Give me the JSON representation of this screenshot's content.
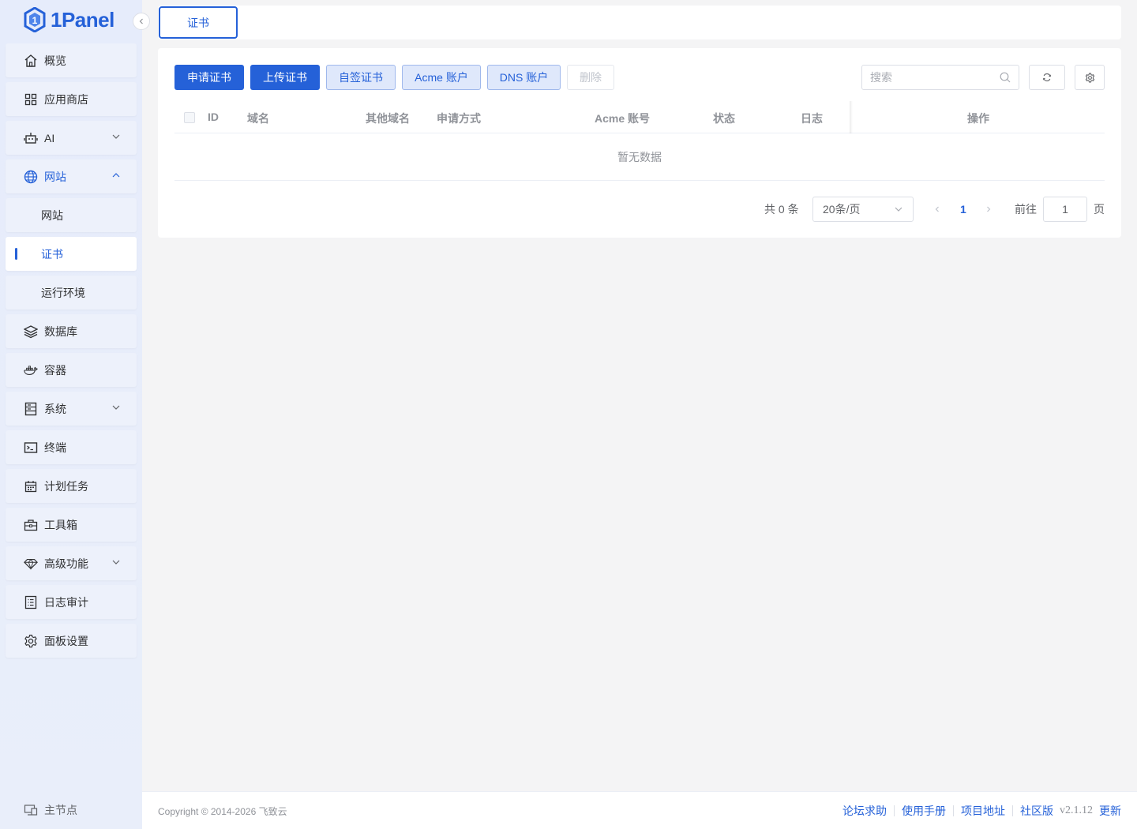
{
  "brand": {
    "name": "1Panel"
  },
  "sidebar": {
    "items": [
      {
        "label": "概览"
      },
      {
        "label": "应用商店"
      },
      {
        "label": "AI"
      },
      {
        "label": "网站"
      },
      {
        "label": "网站"
      },
      {
        "label": "证书"
      },
      {
        "label": "运行环境"
      },
      {
        "label": "数据库"
      },
      {
        "label": "容器"
      },
      {
        "label": "系统"
      },
      {
        "label": "终端"
      },
      {
        "label": "计划任务"
      },
      {
        "label": "工具箱"
      },
      {
        "label": "高级功能"
      },
      {
        "label": "日志审计"
      },
      {
        "label": "面板设置"
      }
    ],
    "node_label": "主节点"
  },
  "tabs": [
    {
      "label": "证书"
    }
  ],
  "toolbar": {
    "apply_label": "申请证书",
    "upload_label": "上传证书",
    "self_signed_label": "自签证书",
    "acme_label": "Acme 账户",
    "dns_label": "DNS 账户",
    "delete_label": "删除",
    "search_placeholder": "搜索"
  },
  "table": {
    "columns": [
      "ID",
      "域名",
      "其他域名",
      "申请方式",
      "Acme 账号",
      "状态",
      "日志",
      "操作"
    ],
    "empty_text": "暂无数据"
  },
  "pagination": {
    "total_text": "共 0 条",
    "page_size": "20条/页",
    "current_page": "1",
    "goto_label": "前往",
    "goto_value": "1",
    "page_suffix": "页"
  },
  "footer": {
    "copyright": "Copyright © 2014-2026 飞致云",
    "links": [
      "论坛求助",
      "使用手册",
      "项目地址",
      "社区版"
    ],
    "version": "v2.1.12",
    "update": "更新"
  },
  "colors": {
    "accent": "#2561d8",
    "sidebar_bg": "#e6ecfb",
    "page_bg": "#f4f4f5"
  }
}
